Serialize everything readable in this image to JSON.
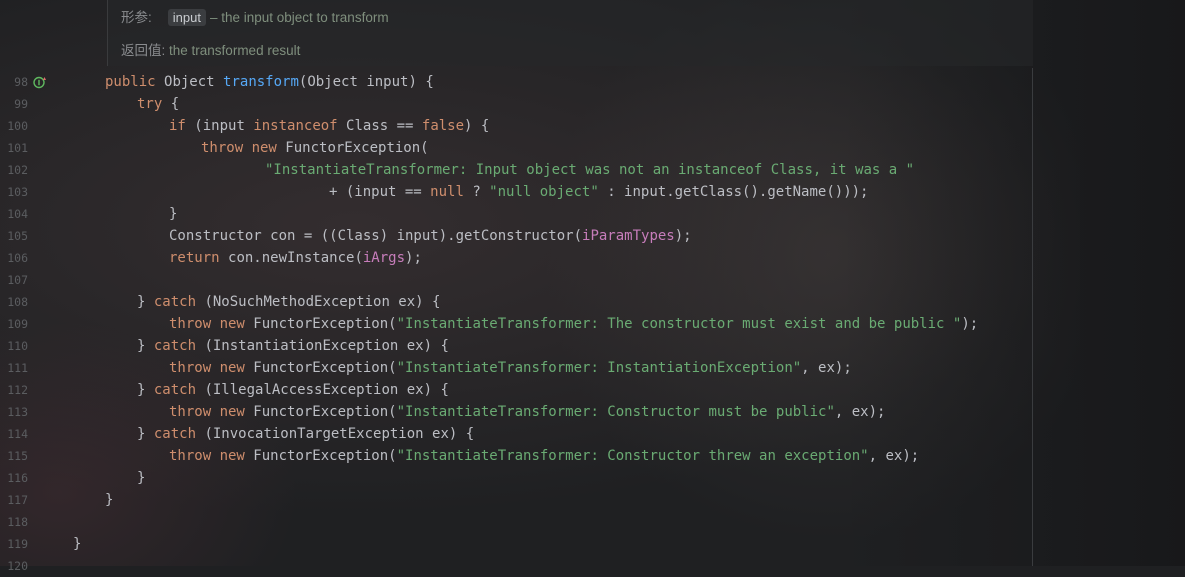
{
  "doc": {
    "param_label": "形参:",
    "param_name": "input",
    "param_desc": "– the input object to transform",
    "return_label": "返回值:",
    "return_desc": "the transformed result"
  },
  "gutter": {
    "line_numbers": [
      "98",
      "99",
      "100",
      "101",
      "102",
      "103",
      "104",
      "105",
      "106",
      "107",
      "108",
      "109",
      "110",
      "111",
      "112",
      "113",
      "114",
      "115",
      "116",
      "117",
      "118",
      "119",
      "120"
    ]
  },
  "code": {
    "lines": [
      {
        "indent": 1,
        "tokens": [
          {
            "t": "kw",
            "v": "public "
          },
          {
            "t": "plain",
            "v": "Object "
          },
          {
            "t": "fn",
            "v": "transform"
          },
          {
            "t": "plain",
            "v": "(Object input) {"
          }
        ]
      },
      {
        "indent": 2,
        "tokens": [
          {
            "t": "kw",
            "v": "try "
          },
          {
            "t": "plain",
            "v": "{"
          }
        ]
      },
      {
        "indent": 3,
        "tokens": [
          {
            "t": "kw",
            "v": "if "
          },
          {
            "t": "plain",
            "v": "(input "
          },
          {
            "t": "kw",
            "v": "instanceof "
          },
          {
            "t": "plain",
            "v": "Class == "
          },
          {
            "t": "kw",
            "v": "false"
          },
          {
            "t": "plain",
            "v": ") {"
          }
        ]
      },
      {
        "indent": 4,
        "tokens": [
          {
            "t": "kw",
            "v": "throw new "
          },
          {
            "t": "plain",
            "v": "FunctorException("
          }
        ]
      },
      {
        "indent": 6,
        "tokens": [
          {
            "t": "str",
            "v": "\"InstantiateTransformer: Input object was not an instanceof Class, it was a \""
          }
        ]
      },
      {
        "indent": 8,
        "tokens": [
          {
            "t": "plain",
            "v": "+ (input == "
          },
          {
            "t": "kw",
            "v": "null "
          },
          {
            "t": "plain",
            "v": "? "
          },
          {
            "t": "str",
            "v": "\"null object\" "
          },
          {
            "t": "plain",
            "v": ": input.getClass().getName()));"
          }
        ]
      },
      {
        "indent": 3,
        "tokens": [
          {
            "t": "plain",
            "v": "}"
          }
        ]
      },
      {
        "indent": 3,
        "tokens": [
          {
            "t": "plain",
            "v": "Constructor con = ((Class) input).getConstructor("
          },
          {
            "t": "fld",
            "v": "iParamTypes"
          },
          {
            "t": "plain",
            "v": ");"
          }
        ]
      },
      {
        "indent": 3,
        "tokens": [
          {
            "t": "kw",
            "v": "return "
          },
          {
            "t": "plain",
            "v": "con.newInstance("
          },
          {
            "t": "fld",
            "v": "iArgs"
          },
          {
            "t": "plain",
            "v": ");"
          }
        ]
      },
      {
        "indent": 0,
        "tokens": []
      },
      {
        "indent": 2,
        "tokens": [
          {
            "t": "plain",
            "v": "} "
          },
          {
            "t": "kw",
            "v": "catch "
          },
          {
            "t": "plain",
            "v": "(NoSuchMethodException ex) {"
          }
        ]
      },
      {
        "indent": 3,
        "tokens": [
          {
            "t": "kw",
            "v": "throw new "
          },
          {
            "t": "plain",
            "v": "FunctorException("
          },
          {
            "t": "str",
            "v": "\"InstantiateTransformer: The constructor must exist and be public \""
          },
          {
            "t": "plain",
            "v": ");"
          }
        ]
      },
      {
        "indent": 2,
        "tokens": [
          {
            "t": "plain",
            "v": "} "
          },
          {
            "t": "kw",
            "v": "catch "
          },
          {
            "t": "plain",
            "v": "(InstantiationException ex) {"
          }
        ]
      },
      {
        "indent": 3,
        "tokens": [
          {
            "t": "kw",
            "v": "throw new "
          },
          {
            "t": "plain",
            "v": "FunctorException("
          },
          {
            "t": "str",
            "v": "\"InstantiateTransformer: InstantiationException\""
          },
          {
            "t": "plain",
            "v": ", ex);"
          }
        ]
      },
      {
        "indent": 2,
        "tokens": [
          {
            "t": "plain",
            "v": "} "
          },
          {
            "t": "kw",
            "v": "catch "
          },
          {
            "t": "plain",
            "v": "(IllegalAccessException ex) {"
          }
        ]
      },
      {
        "indent": 3,
        "tokens": [
          {
            "t": "kw",
            "v": "throw new "
          },
          {
            "t": "plain",
            "v": "FunctorException("
          },
          {
            "t": "str",
            "v": "\"InstantiateTransformer: Constructor must be public\""
          },
          {
            "t": "plain",
            "v": ", ex);"
          }
        ]
      },
      {
        "indent": 2,
        "tokens": [
          {
            "t": "plain",
            "v": "} "
          },
          {
            "t": "kw",
            "v": "catch "
          },
          {
            "t": "plain",
            "v": "(InvocationTargetException ex) {"
          }
        ]
      },
      {
        "indent": 3,
        "tokens": [
          {
            "t": "kw",
            "v": "throw new "
          },
          {
            "t": "plain",
            "v": "FunctorException("
          },
          {
            "t": "str",
            "v": "\"InstantiateTransformer: Constructor threw an exception\""
          },
          {
            "t": "plain",
            "v": ", ex);"
          }
        ]
      },
      {
        "indent": 2,
        "tokens": [
          {
            "t": "plain",
            "v": "}"
          }
        ]
      },
      {
        "indent": 1,
        "tokens": [
          {
            "t": "plain",
            "v": "}"
          }
        ]
      },
      {
        "indent": 0,
        "tokens": []
      },
      {
        "indent": 0,
        "tokens": [
          {
            "t": "plain",
            "v": "}"
          }
        ]
      },
      {
        "indent": 0,
        "tokens": []
      }
    ]
  },
  "gutter_icon": "implements-method-icon",
  "colors": {
    "keyword": "#cf8e6d",
    "function": "#56a8f5",
    "string": "#6aab73",
    "field": "#c77dbb",
    "text": "#bcbec4"
  }
}
